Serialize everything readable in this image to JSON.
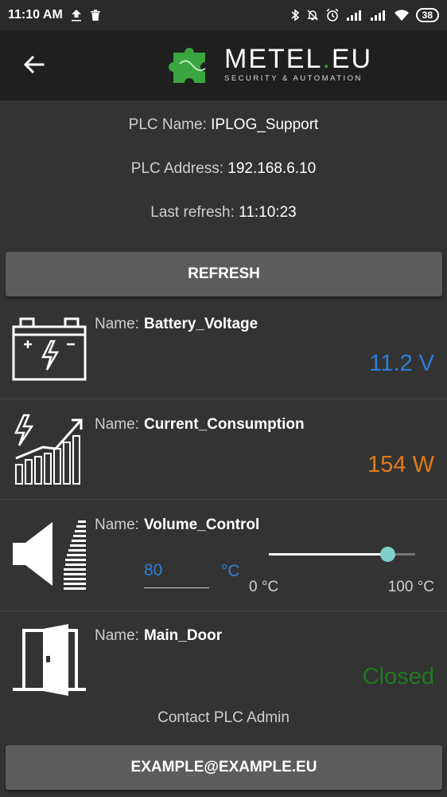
{
  "status_bar": {
    "time": "11:10 AM",
    "battery": "38"
  },
  "app_bar": {
    "logo_title_a": "METEL",
    "logo_title_dot": ".",
    "logo_title_b": "EU",
    "logo_subtitle": "SECURITY & AUTOMATION"
  },
  "plc": {
    "name_label": "PLC Name:",
    "name_value": "IPLOG_Support",
    "address_label": "PLC Address:",
    "address_value": "192.168.6.10",
    "refresh_label": "Last refresh:",
    "refresh_value": "11:10:23"
  },
  "refresh_button": "REFRESH",
  "items": [
    {
      "name_label": "Name:",
      "name": "Battery_Voltage",
      "value": "11.2 V",
      "color": "#2e7fd9",
      "icon": "battery-icon"
    },
    {
      "name_label": "Name:",
      "name": "Current_Consumption",
      "value": "154 W",
      "color": "#e07b1a",
      "icon": "power-chart-icon"
    },
    {
      "name_label": "Name:",
      "name": "Volume_Control",
      "input_value": "80",
      "unit": "°C",
      "slider_min": "0 °C",
      "slider_max": "100 °C",
      "slider_fraction": 0.8,
      "icon": "speaker-icon"
    },
    {
      "name_label": "Name:",
      "name": "Main_Door",
      "value": "Closed",
      "color": "#1f7a1f",
      "icon": "door-icon"
    }
  ],
  "contact_text": "Contact PLC Admin",
  "email_button": "EXAMPLE@EXAMPLE.EU"
}
